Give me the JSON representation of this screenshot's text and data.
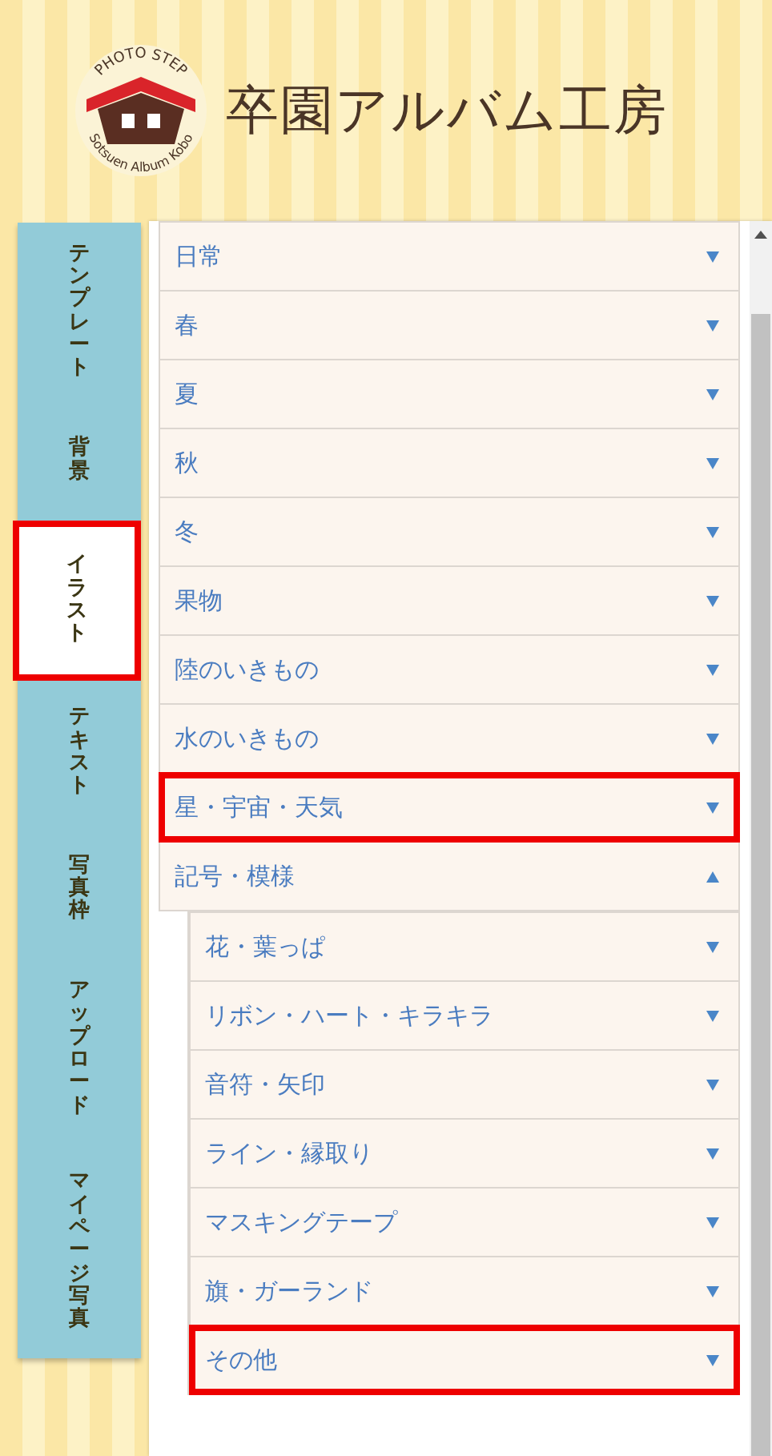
{
  "logo": {
    "arc_top": "PHOTO STEP",
    "arc_bottom": "Sotsuen Album Kobo",
    "title": "卒園アルバム工房"
  },
  "tabs": [
    {
      "label": "テンプレート",
      "selected": false,
      "highlighted": false
    },
    {
      "label": "背景",
      "selected": false,
      "highlighted": false
    },
    {
      "label": "イラスト",
      "selected": true,
      "highlighted": true
    },
    {
      "label": "テキスト",
      "selected": false,
      "highlighted": false
    },
    {
      "label": "写真枠",
      "selected": false,
      "highlighted": false
    },
    {
      "label": "アップロード",
      "selected": false,
      "highlighted": false
    },
    {
      "label": "マイページ写真",
      "selected": false,
      "highlighted": false
    }
  ],
  "categories": [
    {
      "label": "日常",
      "expanded": false,
      "highlighted": false
    },
    {
      "label": "春",
      "expanded": false,
      "highlighted": false
    },
    {
      "label": "夏",
      "expanded": false,
      "highlighted": false
    },
    {
      "label": "秋",
      "expanded": false,
      "highlighted": false
    },
    {
      "label": "冬",
      "expanded": false,
      "highlighted": false
    },
    {
      "label": "果物",
      "expanded": false,
      "highlighted": false
    },
    {
      "label": "陸のいきもの",
      "expanded": false,
      "highlighted": false
    },
    {
      "label": "水のいきもの",
      "expanded": false,
      "highlighted": false
    },
    {
      "label": "星・宇宙・天気",
      "expanded": false,
      "highlighted": true
    },
    {
      "label": "記号・模様",
      "expanded": true,
      "highlighted": false,
      "children": [
        {
          "label": "花・葉っぱ",
          "expanded": false,
          "highlighted": false
        },
        {
          "label": "リボン・ハート・キラキラ",
          "expanded": false,
          "highlighted": false
        },
        {
          "label": "音符・矢印",
          "expanded": false,
          "highlighted": false
        },
        {
          "label": "ライン・縁取り",
          "expanded": false,
          "highlighted": false
        },
        {
          "label": "マスキングテープ",
          "expanded": false,
          "highlighted": false
        },
        {
          "label": "旗・ガーランド",
          "expanded": false,
          "highlighted": false
        },
        {
          "label": "その他",
          "expanded": false,
          "highlighted": true
        }
      ]
    }
  ]
}
